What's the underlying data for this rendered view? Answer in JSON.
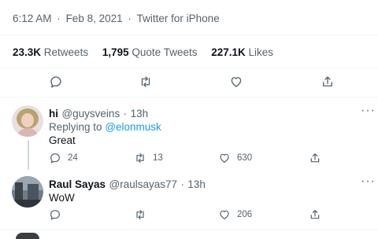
{
  "tweet": {
    "time": "6:12 AM",
    "date": "Feb 8, 2021",
    "separator": "·",
    "client": "Twitter for iPhone",
    "stats": [
      {
        "value": "23.3K",
        "label": "Retweets"
      },
      {
        "value": "1,795",
        "label": "Quote Tweets"
      },
      {
        "value": "227.1K",
        "label": "Likes"
      }
    ],
    "actions": [
      "reply-icon",
      "retweet-icon",
      "like-icon",
      "share-icon"
    ]
  },
  "replies": [
    {
      "name": "hi",
      "handle": "@guysveins",
      "separator": "·",
      "time": "13h",
      "replying_to_label": "Replying to",
      "replying_to_mention": "@elonmusk",
      "text": "Great",
      "counts": {
        "reply": "24",
        "retweet": "13",
        "like": "630"
      },
      "more_label": "···"
    },
    {
      "name": "Raul Sayas",
      "handle": "@raulsayas77",
      "separator": "·",
      "time": "13h",
      "text": "WoW",
      "counts": {
        "reply": "",
        "retweet": "",
        "like": "206"
      },
      "more_label": "···"
    }
  ],
  "colors": {
    "text": "#0f1419",
    "secondary": "#536471",
    "link": "#1d9bf0",
    "divider": "#eff3f4"
  }
}
